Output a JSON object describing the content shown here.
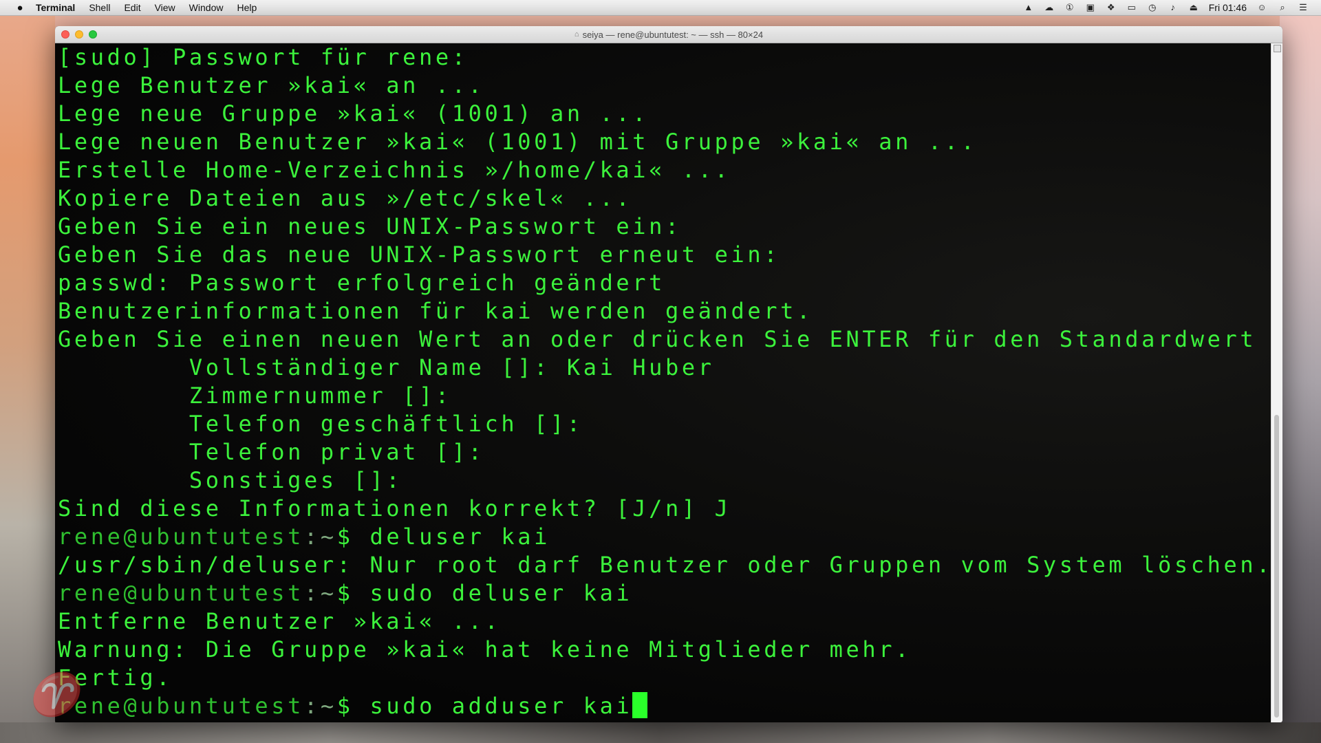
{
  "menubar": {
    "app_name": "Terminal",
    "items": [
      "Shell",
      "Edit",
      "View",
      "Window",
      "Help"
    ],
    "clock": "Fri 01:46"
  },
  "window": {
    "title": "seiya — rene@ubuntutest: ~ — ssh — 80×24"
  },
  "terminal": {
    "lines": [
      "[sudo] Passwort für rene:",
      "Lege Benutzer »kai« an ...",
      "Lege neue Gruppe »kai« (1001) an ...",
      "Lege neuen Benutzer »kai« (1001) mit Gruppe »kai« an ...",
      "Erstelle Home-Verzeichnis »/home/kai« ...",
      "Kopiere Dateien aus »/etc/skel« ...",
      "Geben Sie ein neues UNIX-Passwort ein:",
      "Geben Sie das neue UNIX-Passwort erneut ein:",
      "passwd: Passwort erfolgreich geändert",
      "Benutzerinformationen für kai werden geändert.",
      "Geben Sie einen neuen Wert an oder drücken Sie ENTER für den Standardwert",
      "        Vollständiger Name []: Kai Huber",
      "        Zimmernummer []:",
      "        Telefon geschäftlich []:",
      "        Telefon privat []:",
      "        Sonstiges []:",
      "Sind diese Informationen korrekt? [J/n] J"
    ],
    "prompt_user": "rene@ubuntutest",
    "prompt_sep": ":",
    "prompt_path": "~",
    "prompt_sign": "$ ",
    "cmd1": "deluser kai",
    "out1": "/usr/sbin/deluser: Nur root darf Benutzer oder Gruppen vom System löschen.",
    "cmd2": "sudo deluser kai",
    "out2a": "Entferne Benutzer »kai« ...",
    "out2b": "Warnung: Die Gruppe »kai« hat keine Mitglieder mehr.",
    "out2c": "Fertig.",
    "cmd3": "sudo adduser kai"
  }
}
